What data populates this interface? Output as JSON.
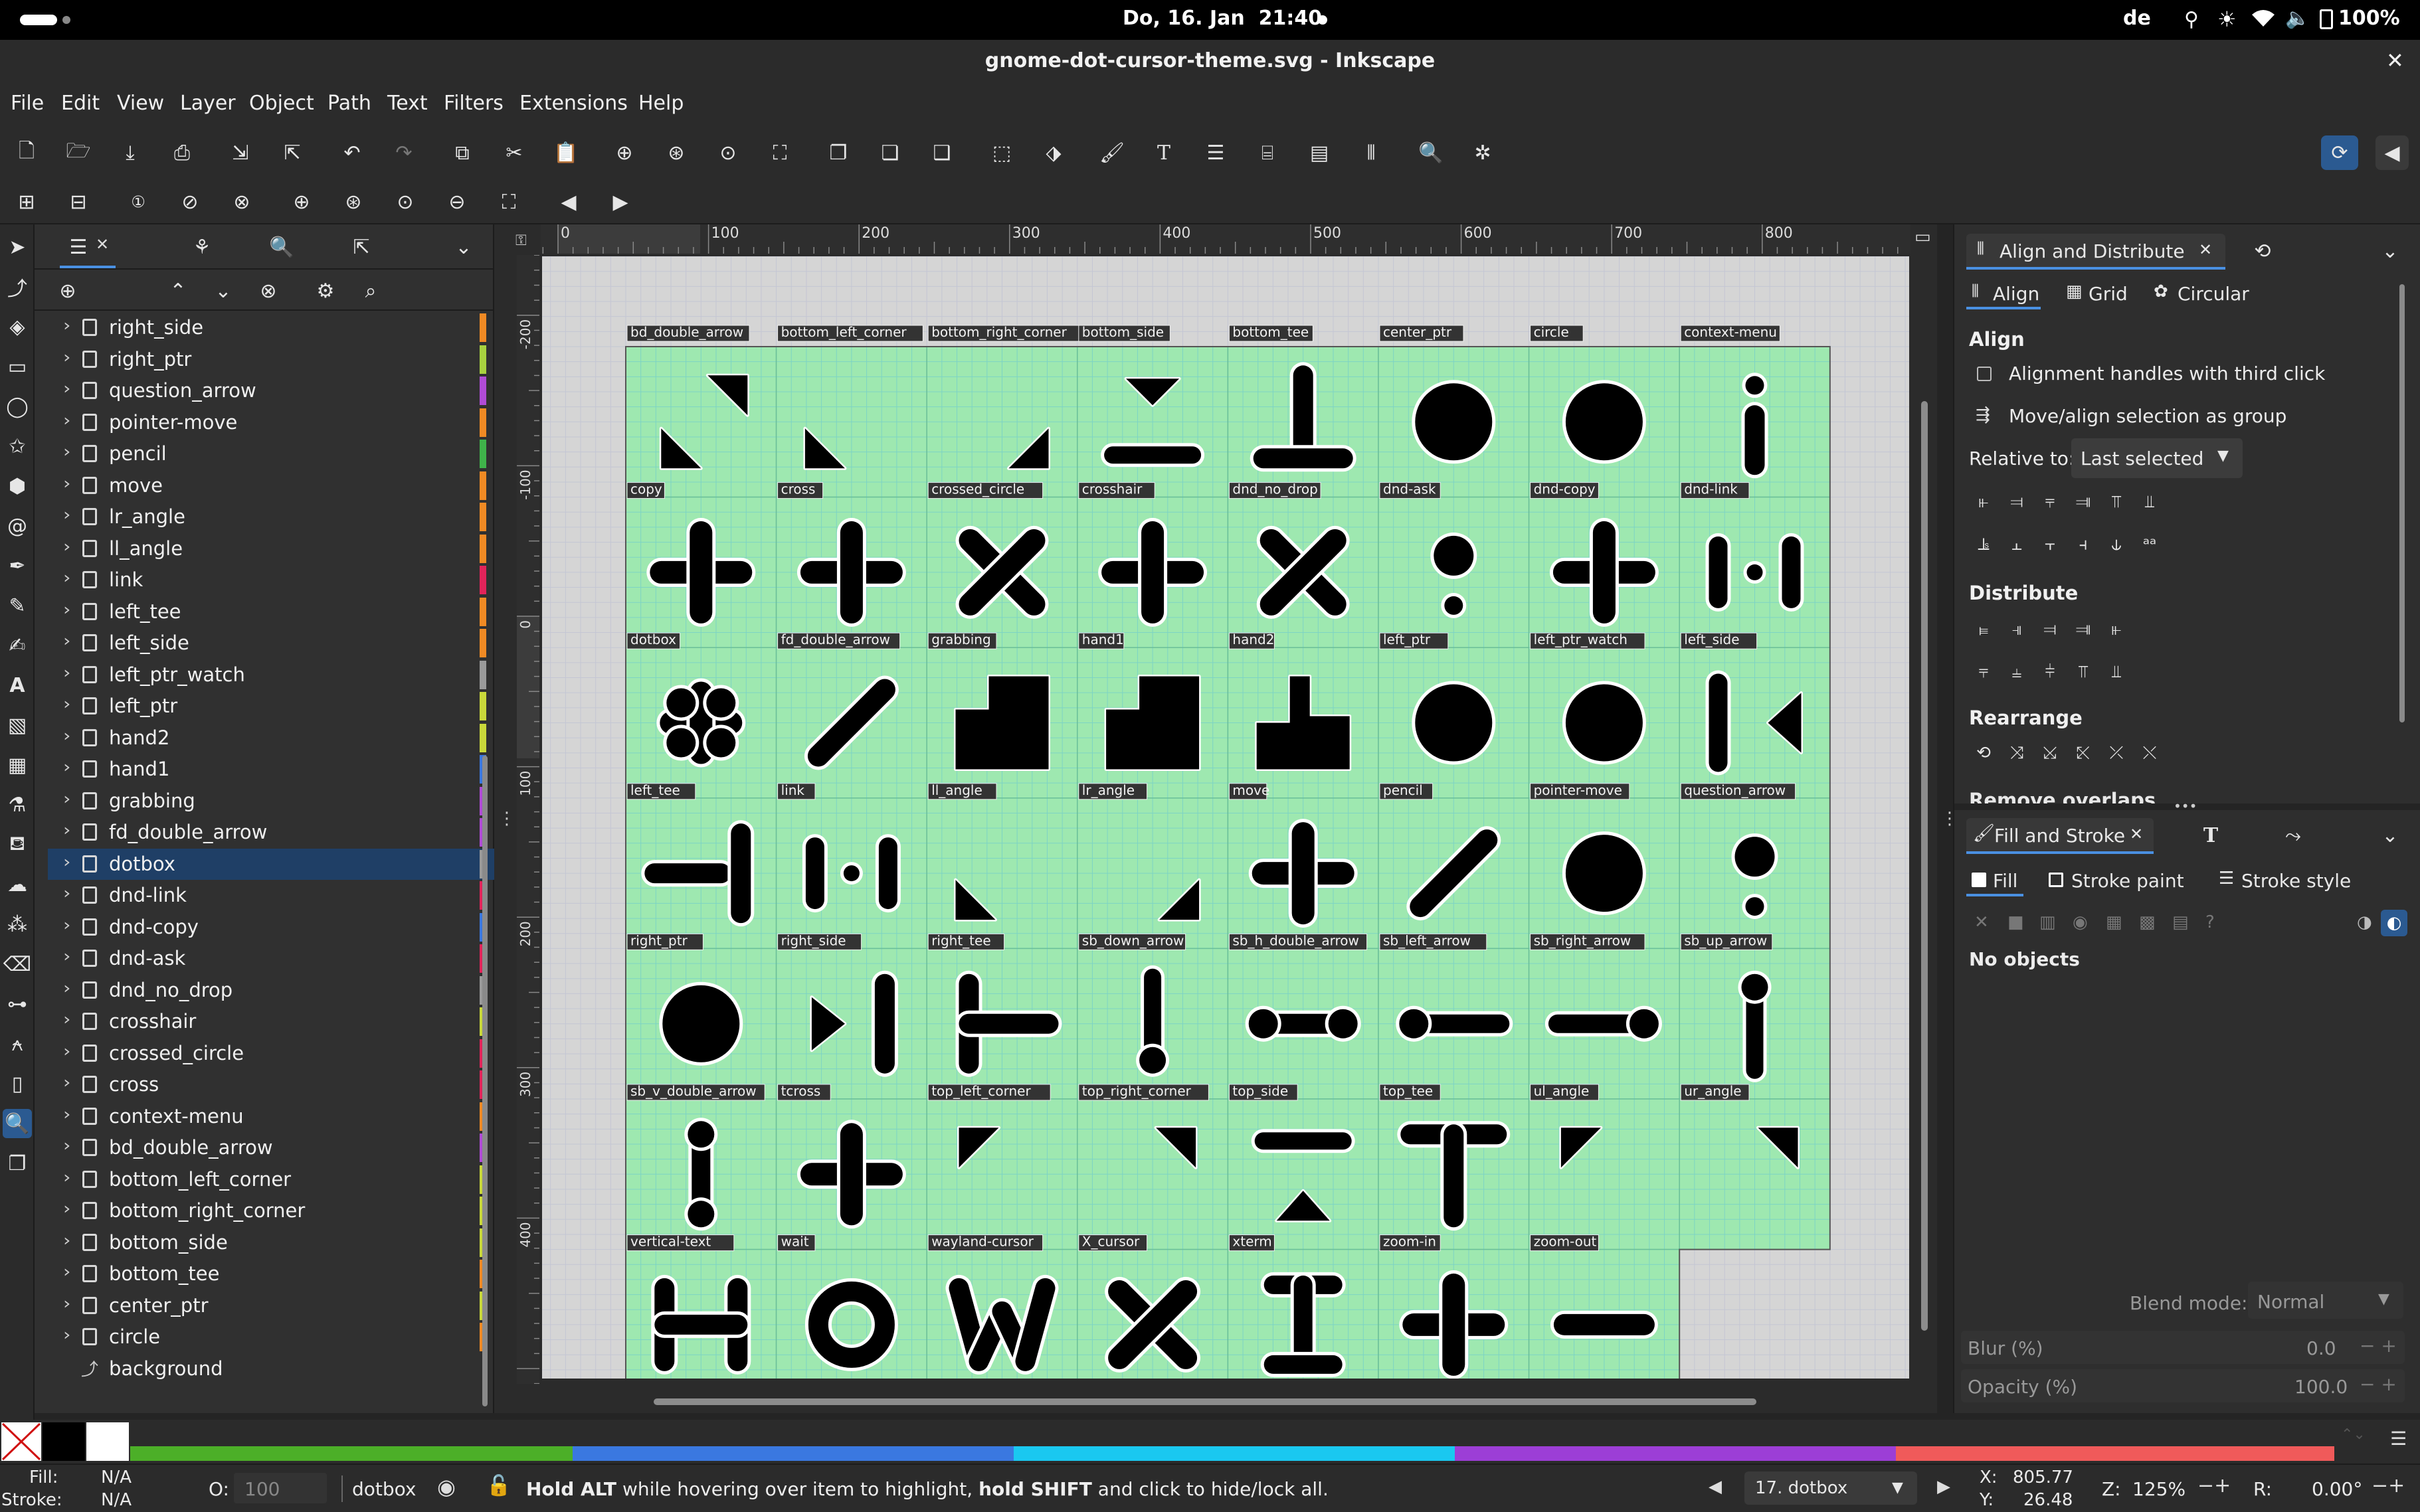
{
  "topbar": {
    "datetime": "Do, 16. Jan  21:40",
    "keyboard": "de",
    "battery": "100%"
  },
  "window": {
    "title": "gnome-dot-cursor-theme.svg - Inkscape",
    "close": "✕"
  },
  "menu": [
    "File",
    "Edit",
    "View",
    "Layer",
    "Object",
    "Path",
    "Text",
    "Filters",
    "Extensions",
    "Help"
  ],
  "layers": {
    "items": [
      {
        "name": "right_side",
        "color": "#f08a24"
      },
      {
        "name": "right_ptr",
        "color": "#a8d13f"
      },
      {
        "name": "question_arrow",
        "color": "#b04bd6"
      },
      {
        "name": "pointer-move",
        "color": "#f08a24"
      },
      {
        "name": "pencil",
        "color": "#3fb34a"
      },
      {
        "name": "move",
        "color": "#f08a24"
      },
      {
        "name": "lr_angle",
        "color": "#f08a24"
      },
      {
        "name": "ll_angle",
        "color": "#f08a24"
      },
      {
        "name": "link",
        "color": "#e2245a"
      },
      {
        "name": "left_tee",
        "color": "#f08a24"
      },
      {
        "name": "left_side",
        "color": "#f08a24"
      },
      {
        "name": "left_ptr_watch",
        "color": "#9a9a9a"
      },
      {
        "name": "left_ptr",
        "color": "#c9d83a"
      },
      {
        "name": "hand2",
        "color": "#c9d83a"
      },
      {
        "name": "hand1",
        "color": "#3a78e0"
      },
      {
        "name": "grabbing",
        "color": "#b04bd6"
      },
      {
        "name": "fd_double_arrow",
        "color": "#b04bd6"
      },
      {
        "name": "dotbox",
        "color": "#9a9a9a"
      },
      {
        "name": "dnd-link",
        "color": "#e2245a"
      },
      {
        "name": "dnd-copy",
        "color": "#3a78e0"
      },
      {
        "name": "dnd-ask",
        "color": "#e2245a"
      },
      {
        "name": "dnd_no_drop",
        "color": "#9a9a9a"
      },
      {
        "name": "crosshair",
        "color": "#c9d83a"
      },
      {
        "name": "crossed_circle",
        "color": "#e2245a"
      },
      {
        "name": "cross",
        "color": "#e2245a"
      },
      {
        "name": "context-menu",
        "color": "#f08a24"
      },
      {
        "name": "bd_double_arrow",
        "color": "#b04bd6"
      },
      {
        "name": "bottom_left_corner",
        "color": "#c9d83a"
      },
      {
        "name": "bottom_right_corner",
        "color": "#c9d83a"
      },
      {
        "name": "bottom_side",
        "color": "#c9d83a"
      },
      {
        "name": "bottom_tee",
        "color": "#f08a24"
      },
      {
        "name": "center_ptr",
        "color": "#c9d83a"
      },
      {
        "name": "circle",
        "color": "#f08a24"
      },
      {
        "name": "background",
        "color": ""
      }
    ],
    "selected": "dotbox"
  },
  "rulers": {
    "h": [
      "0",
      "100",
      "200",
      "300",
      "400",
      "500",
      "600",
      "700",
      "800"
    ],
    "v": [
      "-200",
      "-100",
      "0",
      "100",
      "200",
      "300",
      "400"
    ]
  },
  "canvas": {
    "top_labels": [
      "bd_double_arrow",
      "bottom_left_corner",
      "bottom_right_corner",
      "bottom_side",
      "bottom_tee",
      "center_ptr",
      "circle",
      "context-menu"
    ],
    "row_labels": [
      [
        "copy",
        "cross",
        "crossed_circle",
        "crosshair",
        "dnd_no_drop",
        "dnd-ask",
        "dnd-copy",
        "dnd-link"
      ],
      [
        "dotbox",
        "fd_double_arrow",
        "grabbing",
        "hand1",
        "hand2",
        "left_ptr",
        "left_ptr_watch",
        "left_side"
      ],
      [
        "left_tee",
        "link",
        "ll_angle",
        "lr_angle",
        "move",
        "pencil",
        "pointer-move",
        "question_arrow"
      ],
      [
        "right_ptr",
        "right_side",
        "right_tee",
        "sb_down_arrow",
        "sb_h_double_arrow",
        "sb_left_arrow",
        "sb_right_arrow",
        "sb_up_arrow"
      ],
      [
        "sb_v_double_arrow",
        "tcross",
        "top_left_corner",
        "top_right_corner",
        "top_side",
        "top_tee",
        "ul_angle",
        "ur_angle"
      ],
      [
        "vertical-text",
        "wait",
        "wayland-cursor",
        "X_cursor",
        "xterm",
        "zoom-in",
        "zoom-out",
        ""
      ]
    ]
  },
  "align_panel": {
    "title": "Align and Distribute",
    "tabs": [
      "Align",
      "Grid",
      "Circular"
    ],
    "align_heading": "Align",
    "opt1": "Alignment handles with third click",
    "opt2": "Move/align selection as group",
    "relative_label": "Relative to:",
    "relative_value": "Last selected",
    "distribute_heading": "Distribute",
    "rearrange_heading": "Rearrange",
    "remove_overlaps": "Remove overlaps"
  },
  "fill_panel": {
    "title": "Fill and Stroke",
    "tabs": [
      "Fill",
      "Stroke paint",
      "Stroke style"
    ],
    "no_objects": "No objects",
    "blend_label": "Blend mode:",
    "blend_value": "Normal",
    "blur_label": "Blur (%)",
    "blur_value": "0.0",
    "opacity_label": "Opacity (%)",
    "opacity_value": "100.0"
  },
  "status": {
    "fill_label": "Fill:",
    "fill_value": "N/A",
    "stroke_label": "Stroke:",
    "stroke_value": "N/A",
    "o_label": "O:",
    "o_value": "100",
    "layer_name": "dotbox",
    "message_bold1": "Hold ALT",
    "message1": " while hovering over item to highlight, ",
    "message_bold2": "hold SHIFT",
    "message2": " and click to hide/lock all.",
    "page_select": "17. dotbox",
    "x_label": "X:",
    "x_value": "805.77",
    "y_label": "Y:",
    "y_value": "26.48",
    "z_label": "Z:",
    "zoom": "125%",
    "r_label": "R:",
    "rotation": "0.00°"
  },
  "colors": {
    "accent": "#1f3f66",
    "canvas_green": "#9ee8b0",
    "desk": "#d2d2d2"
  }
}
